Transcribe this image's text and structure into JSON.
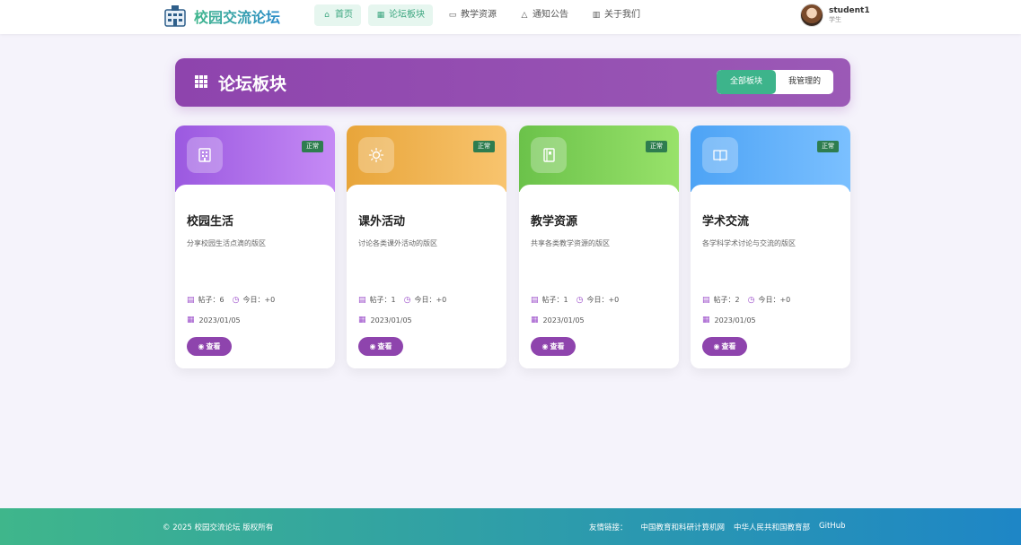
{
  "brand": {
    "name": "校园交流论坛"
  },
  "nav": [
    {
      "label": "首页",
      "icon": "home-icon",
      "active": true
    },
    {
      "label": "论坛板块",
      "icon": "grid-icon",
      "active": true
    },
    {
      "label": "教学资源",
      "icon": "folder-icon",
      "active": false
    },
    {
      "label": "通知公告",
      "icon": "bell-icon",
      "active": false
    },
    {
      "label": "关于我们",
      "icon": "building-icon",
      "active": false
    }
  ],
  "user": {
    "name": "student1",
    "role": "学生"
  },
  "page": {
    "title": "论坛板块",
    "filter_all": "全部板块",
    "filter_mine": "我管理的"
  },
  "boards": [
    {
      "title": "校园生活",
      "desc": "分享校园生活点滴的版区",
      "status": "正常",
      "posts_label": "帖子：6",
      "today_label": "今日：+0",
      "date": "2023/01/05",
      "view_label": "查看",
      "icon": "building-icon",
      "color_from": "#9b59e0",
      "color_to": "#c58af5"
    },
    {
      "title": "课外活动",
      "desc": "讨论各类课外活动的版区",
      "status": "正常",
      "posts_label": "帖子：1",
      "today_label": "今日：+0",
      "date": "2023/01/05",
      "view_label": "查看",
      "icon": "sun-icon",
      "color_from": "#e8a53a",
      "color_to": "#f8c46e"
    },
    {
      "title": "教学资源",
      "desc": "共享各类教学资源的版区",
      "status": "正常",
      "posts_label": "帖子：1",
      "today_label": "今日：+0",
      "date": "2023/01/05",
      "view_label": "查看",
      "icon": "book-icon",
      "color_from": "#6bc24a",
      "color_to": "#98e26a"
    },
    {
      "title": "学术交流",
      "desc": "各学科学术讨论与交流的版区",
      "status": "正常",
      "posts_label": "帖子：2",
      "today_label": "今日：+0",
      "date": "2023/01/05",
      "view_label": "查看",
      "icon": "open-book-icon",
      "color_from": "#4da3f5",
      "color_to": "#7bc0ff"
    }
  ],
  "footer": {
    "copyright": "© 2025 校园交流论坛 版权所有",
    "links_label": "友情链接：",
    "links": [
      "中国教育和科研计算机网",
      "中华人民共和国教育部",
      "GitHub"
    ]
  }
}
